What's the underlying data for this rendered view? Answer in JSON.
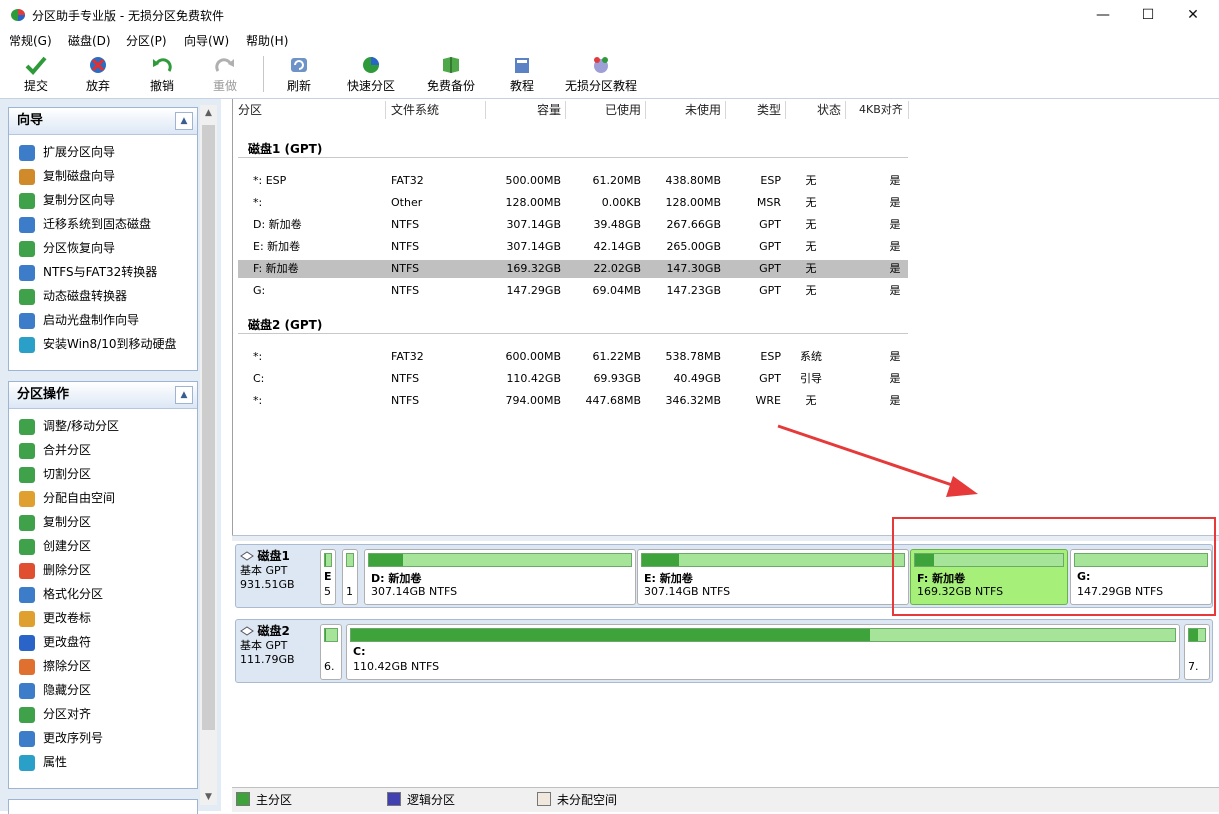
{
  "window": {
    "title": "分区助手专业版 - 无损分区免费软件",
    "controls": {
      "minimize": "—",
      "maximize": "☐",
      "close": "✕"
    }
  },
  "menu": [
    "常规(G)",
    "磁盘(D)",
    "分区(P)",
    "向导(W)",
    "帮助(H)"
  ],
  "toolbar": {
    "commit": "提交",
    "discard": "放弃",
    "undo": "撤销",
    "redo": "重做",
    "refresh": "刷新",
    "quick_partition": "快速分区",
    "free_backup": "免费备份",
    "tutorial": "教程",
    "lossless_tutorial": "无损分区教程"
  },
  "wizard_panel": {
    "title": "向导",
    "items": [
      "扩展分区向导",
      "复制磁盘向导",
      "复制分区向导",
      "迁移系统到固态磁盘",
      "分区恢复向导",
      "NTFS与FAT32转换器",
      "动态磁盘转换器",
      "启动光盘制作向导",
      "安装Win8/10到移动硬盘"
    ]
  },
  "ops_panel": {
    "title": "分区操作",
    "items": [
      "调整/移动分区",
      "合并分区",
      "切割分区",
      "分配自由空间",
      "复制分区",
      "创建分区",
      "删除分区",
      "格式化分区",
      "更改卷标",
      "更改盘符",
      "擦除分区",
      "隐藏分区",
      "分区对齐",
      "更改序列号",
      "属性"
    ]
  },
  "table": {
    "columns": [
      "分区",
      "文件系统",
      "容量",
      "已使用",
      "未使用",
      "类型",
      "状态",
      "4KB对齐"
    ],
    "disk1_label": "磁盘1 (GPT)",
    "disk1_rows": [
      [
        "*: ESP",
        "FAT32",
        "500.00MB",
        "61.20MB",
        "438.80MB",
        "ESP",
        "无",
        "是"
      ],
      [
        "*:",
        "Other",
        "128.00MB",
        "0.00KB",
        "128.00MB",
        "MSR",
        "无",
        "是"
      ],
      [
        "D: 新加卷",
        "NTFS",
        "307.14GB",
        "39.48GB",
        "267.66GB",
        "GPT",
        "无",
        "是"
      ],
      [
        "E: 新加卷",
        "NTFS",
        "307.14GB",
        "42.14GB",
        "265.00GB",
        "GPT",
        "无",
        "是"
      ],
      [
        "F: 新加卷",
        "NTFS",
        "169.32GB",
        "22.02GB",
        "147.30GB",
        "GPT",
        "无",
        "是"
      ],
      [
        "G:",
        "NTFS",
        "147.29GB",
        "69.04MB",
        "147.23GB",
        "GPT",
        "无",
        "是"
      ]
    ],
    "disk1_selected_row": 4,
    "disk2_label": "磁盘2 (GPT)",
    "disk2_rows": [
      [
        "*:",
        "FAT32",
        "600.00MB",
        "61.22MB",
        "538.78MB",
        "ESP",
        "系统",
        "是"
      ],
      [
        "C:",
        "NTFS",
        "110.42GB",
        "69.93GB",
        "40.49GB",
        "GPT",
        "引导",
        "是"
      ],
      [
        "*:",
        "NTFS",
        "794.00MB",
        "447.68MB",
        "346.32MB",
        "WRE",
        "无",
        "是"
      ]
    ]
  },
  "diskmap": {
    "disk1": {
      "name": "磁盘1",
      "kind": "基本 GPT",
      "size": "931.51GB",
      "partitions": [
        {
          "name": "E",
          "info": "5",
          "used": 0.12
        },
        {
          "name": "",
          "info": "1",
          "used": 0.0
        },
        {
          "name": "D: 新加卷",
          "info": "307.14GB NTFS",
          "used": 0.13
        },
        {
          "name": "E: 新加卷",
          "info": "307.14GB NTFS",
          "used": 0.14
        },
        {
          "name": "F: 新加卷",
          "info": "169.32GB NTFS",
          "used": 0.13
        },
        {
          "name": "G:",
          "info": "147.29GB NTFS",
          "used": 0.0
        }
      ]
    },
    "disk2": {
      "name": "磁盘2",
      "kind": "基本 GPT",
      "size": "111.79GB",
      "partitions": [
        {
          "name": "",
          "info": "6.",
          "used": 0.1
        },
        {
          "name": "C:",
          "info": "110.42GB NTFS",
          "used": 0.63
        },
        {
          "name": "",
          "info": "7.",
          "used": 0.56
        }
      ]
    }
  },
  "legend": {
    "primary": "主分区",
    "logical": "逻辑分区",
    "unallocated": "未分配空间"
  },
  "colors": {
    "primary": "#3ea33a",
    "logical": "#4040b0",
    "unallocated": "#f0e8dc",
    "selected": "#a6f07a",
    "highlight_box": "#e63939"
  }
}
